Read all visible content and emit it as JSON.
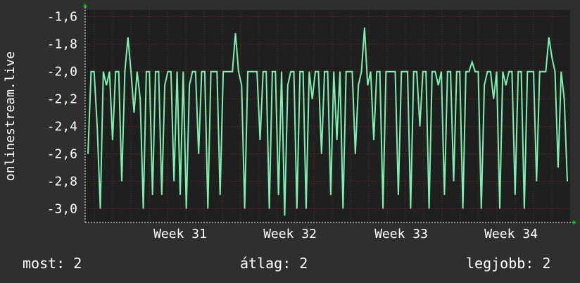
{
  "chart_data": {
    "type": "line",
    "ylabel": "onlinestream.live",
    "ylim": [
      -3.1,
      -1.55
    ],
    "y_ticks": [
      -1.6,
      -1.8,
      -2.0,
      -2.2,
      -2.4,
      -2.6,
      -2.8,
      -3.0
    ],
    "y_tick_labels": [
      "-1,6",
      "-1,8",
      "-2,0",
      "-2,2",
      "-2,4",
      "-2,6",
      "-2,8",
      "-3,0"
    ],
    "x_tick_labels": [
      "Week 31",
      "Week 32",
      "Week 33",
      "Week 34"
    ],
    "grid": true,
    "colors": {
      "background": "#2f2f2f",
      "plot_bg": "#1f1f1f",
      "line": "#7cf2b0",
      "grid": "#7a2a2a",
      "arrow": "#00cc00"
    },
    "series": [
      {
        "values": [
          -2.6,
          -2.0,
          -2.0,
          -2.4,
          -3.0,
          -2.0,
          -2.1,
          -2.0,
          -2.5,
          -2.0,
          -2.0,
          -2.8,
          -2.0,
          -1.75,
          -2.0,
          -2.3,
          -2.0,
          -2.2,
          -3.0,
          -2.0,
          -2.0,
          -2.9,
          -2.0,
          -2.0,
          -2.9,
          -2.1,
          -2.0,
          -2.0,
          -2.8,
          -2.0,
          -2.9,
          -2.0,
          -3.0,
          -2.1,
          -2.0,
          -2.0,
          -2.6,
          -2.0,
          -2.0,
          -3.0,
          -2.0,
          -2.0,
          -2.0,
          -2.9,
          -2.0,
          -2.0,
          -2.0,
          -2.0,
          -1.72,
          -2.0,
          -2.1,
          -3.0,
          -2.0,
          -2.0,
          -2.0,
          -2.0,
          -2.5,
          -2.0,
          -2.0,
          -3.0,
          -2.0,
          -2.0,
          -2.9,
          -2.0,
          -3.05,
          -2.1,
          -2.0,
          -2.0,
          -3.0,
          -2.0,
          -2.0,
          -3.0,
          -2.0,
          -2.2,
          -2.0,
          -2.0,
          -2.6,
          -2.0,
          -2.0,
          -2.9,
          -2.0,
          -2.5,
          -2.0,
          -3.0,
          -2.0,
          -2.0,
          -2.0,
          -2.6,
          -2.1,
          -2.0,
          -1.68,
          -2.1,
          -2.0,
          -2.5,
          -2.0,
          -2.0,
          -3.0,
          -2.0,
          -2.0,
          -2.0,
          -2.0,
          -2.9,
          -2.0,
          -2.0,
          -2.0,
          -3.0,
          -2.0,
          -2.0,
          -2.4,
          -2.0,
          -2.0,
          -3.0,
          -2.0,
          -2.0,
          -2.1,
          -2.0,
          -2.9,
          -2.0,
          -2.0,
          -2.8,
          -2.0,
          -2.0,
          -3.0,
          -2.0,
          -2.0,
          -1.93,
          -2.0,
          -2.0,
          -3.0,
          -2.1,
          -2.0,
          -2.0,
          -2.2,
          -2.0,
          -3.0,
          -2.0,
          -2.1,
          -2.0,
          -2.0,
          -2.9,
          -2.0,
          -2.0,
          -3.0,
          -2.0,
          -2.0,
          -2.0,
          -2.8,
          -2.0,
          -2.0,
          -2.0,
          -1.75,
          -1.9,
          -2.0,
          -2.7,
          -2.0,
          -2.2,
          -2.8
        ],
        "color": "#7cf2b0"
      }
    ]
  },
  "footer": {
    "current": "most: 2",
    "average": "átlag: 2",
    "best": "legjobb: 2"
  }
}
